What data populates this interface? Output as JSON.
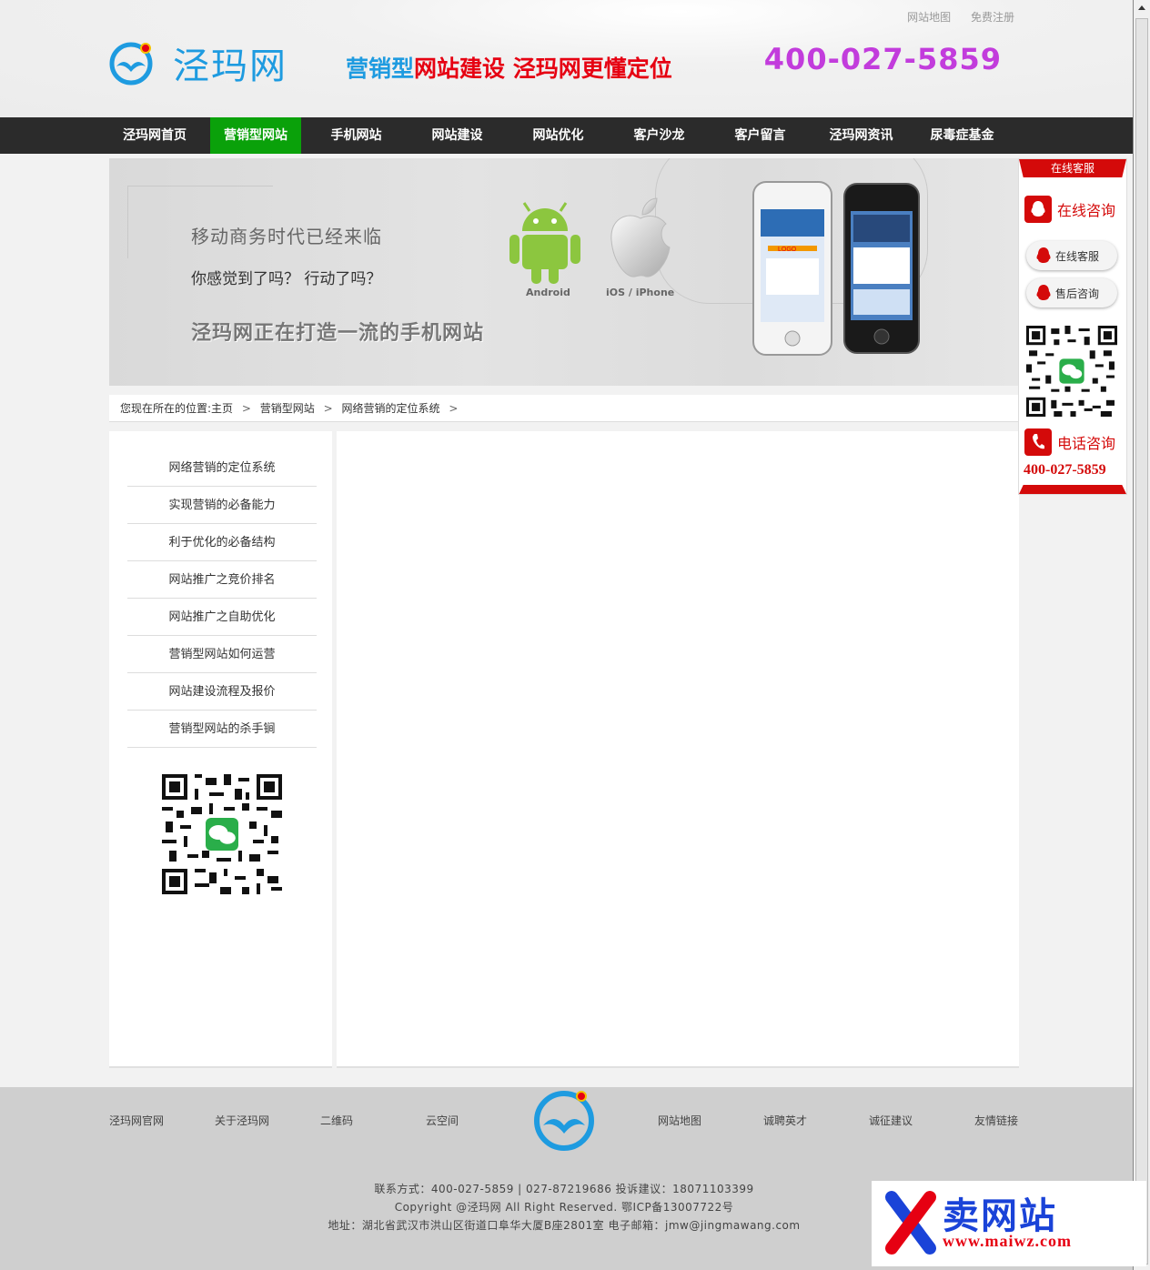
{
  "header": {
    "toplinks": [
      "网站地图",
      "免费注册"
    ],
    "logo_text": "泾玛网",
    "slogan_part1": "营销型",
    "slogan_part2": "网站建设 泾玛网更懂定位",
    "phone": "400-027-5859"
  },
  "nav": {
    "items": [
      "泾玛网首页",
      "营销型网站",
      "手机网站",
      "网站建设",
      "网站优化",
      "客户沙龙",
      "客户留言",
      "泾玛网资讯",
      "尿毒症基金"
    ],
    "active_index": 1,
    "active_color": "#0aa10a"
  },
  "banner": {
    "line1": "移动商务时代已经来临",
    "line2": "你感觉到了吗？  行动了吗？",
    "line3": "泾玛网正在打造一流的手机网站",
    "android_label": "Android",
    "ios_label": "iOS / iPhone",
    "screen_logo": "LOGO"
  },
  "breadcrumb": {
    "prefix": "您现在所在的位置:",
    "items": [
      "主页",
      "营销型网站",
      "网络营销的定位系统"
    ],
    "sep": ">"
  },
  "sidebar": {
    "items": [
      "网络营销的定位系统",
      "实现营销的必备能力",
      "利于优化的必备结构",
      "网站推广之竞价排名",
      "网站推广之自助优化",
      "营销型网站如何运营",
      "网站建设流程及报价",
      "营销型网站的杀手锏"
    ]
  },
  "float_panel": {
    "title": "在线客服",
    "online_label": "在线咨询",
    "pill1": "在线客服",
    "pill2": "售后咨询",
    "tel_label": "电话咨询",
    "tel_number": "400-027-5859",
    "accent": "#d40a0a"
  },
  "footer": {
    "links_left": [
      "泾玛网官网",
      "关于泾玛网",
      "二维码",
      "云空间"
    ],
    "links_right": [
      "网站地图",
      "诚聘英才",
      "诚征建议",
      "友情链接"
    ],
    "contact": "联系方式：400-027-5859 | 027-87219686 投诉建议：18071103399",
    "copyright": "Copyright @泾玛网 All Right Reserved. 鄂ICP备13007722号",
    "address": "地址：湖北省武汉市洪山区街道口阜华大厦B座2801室 电子邮箱：jmw@jingmawang.com"
  },
  "watermark": {
    "text": "卖网站",
    "url": "www.maiwz.com"
  }
}
